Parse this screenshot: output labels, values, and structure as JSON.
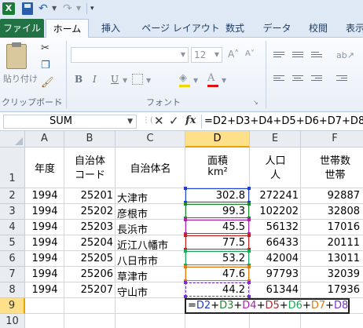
{
  "qat": {
    "app_icon": "X",
    "icons": [
      "excel-logo-icon",
      "save-icon",
      "undo-icon",
      "redo-icon",
      "customize-qat-icon"
    ]
  },
  "tabs": [
    {
      "label": "ファイル"
    },
    {
      "label": "ホーム"
    },
    {
      "label": "挿入"
    },
    {
      "label": "ページ レイアウト"
    },
    {
      "label": "数式"
    },
    {
      "label": "データ"
    },
    {
      "label": "校閲"
    },
    {
      "label": "表示"
    }
  ],
  "ribbon": {
    "clipboard": {
      "paste_label": "貼り付け",
      "group_label": "クリップボード"
    },
    "font": {
      "font_name": "",
      "font_size": "12",
      "group_label": "フォント",
      "fill_color": "#f2d600",
      "font_color": "#d11111"
    }
  },
  "formula_bar": {
    "name_box": "SUM",
    "formula": "=D2+D3+D4+D5+D6+D7+D8"
  },
  "grid": {
    "columns": [
      "A",
      "B",
      "C",
      "D",
      "E",
      "F"
    ],
    "rows": [
      "1",
      "2",
      "3",
      "4",
      "5",
      "6",
      "7",
      "8",
      "9",
      "10"
    ],
    "header": {
      "a": "年度",
      "b1": "自治体",
      "b2": "コード",
      "c": "自治体名",
      "d1": "面積",
      "d2": "km²",
      "e1": "人口",
      "e2": "人",
      "f1": "世帯数",
      "f2": "世帯"
    },
    "data": [
      {
        "year": "1994",
        "code": "25201",
        "name": "大津市",
        "area": "302.8",
        "pop": "272241",
        "hh": "92887"
      },
      {
        "year": "1994",
        "code": "25202",
        "name": "彦根市",
        "area": "99.3",
        "pop": "102202",
        "hh": "32808"
      },
      {
        "year": "1994",
        "code": "25203",
        "name": "長浜市",
        "area": "45.5",
        "pop": "56132",
        "hh": "17016"
      },
      {
        "year": "1994",
        "code": "25204",
        "name": "近江八幡市",
        "area": "77.5",
        "pop": "66433",
        "hh": "20111"
      },
      {
        "year": "1994",
        "code": "25205",
        "name": "八日市市",
        "area": "53.2",
        "pop": "42004",
        "hh": "13011"
      },
      {
        "year": "1994",
        "code": "25206",
        "name": "草津市",
        "area": "47.6",
        "pop": "97793",
        "hh": "32039"
      },
      {
        "year": "1994",
        "code": "25207",
        "name": "守山市",
        "area": "44.2",
        "pop": "61344",
        "hh": "17936"
      }
    ],
    "edit_cell": {
      "tokens": [
        {
          "text": "=",
          "color": "#000000"
        },
        {
          "text": "D2",
          "color": "#1f3fd0"
        },
        {
          "text": "+",
          "color": "#000000"
        },
        {
          "text": "D3",
          "color": "#1a8a2a"
        },
        {
          "text": "+",
          "color": "#000000"
        },
        {
          "text": "D4",
          "color": "#b020b0"
        },
        {
          "text": "+",
          "color": "#000000"
        },
        {
          "text": "D5",
          "color": "#c02020"
        },
        {
          "text": "+",
          "color": "#000000"
        },
        {
          "text": "D6",
          "color": "#1aa85a"
        },
        {
          "text": "+",
          "color": "#000000"
        },
        {
          "text": "D7",
          "color": "#e07a10"
        },
        {
          "text": "+",
          "color": "#000000"
        },
        {
          "text": "D8",
          "color": "#7a30c8"
        }
      ]
    },
    "ref_colors": [
      "#1f3fd0",
      "#1a8a2a",
      "#b020b0",
      "#c02020",
      "#1aa85a",
      "#e07a10",
      "#7a30c8"
    ]
  }
}
